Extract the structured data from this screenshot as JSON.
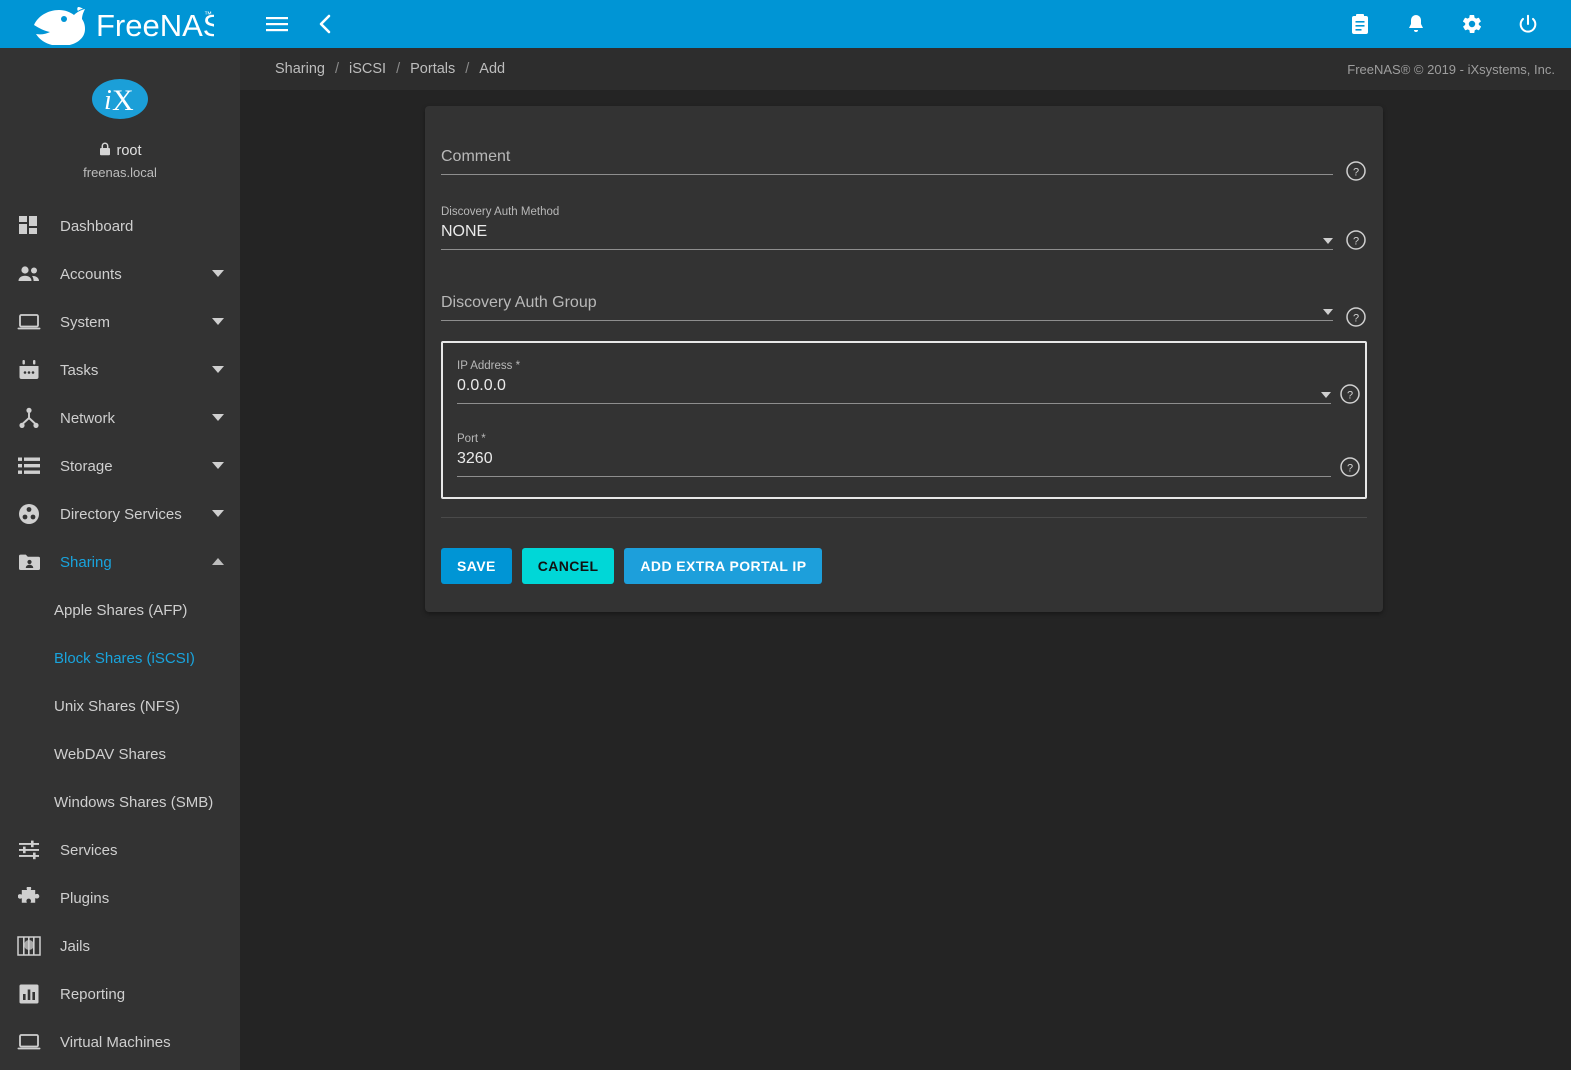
{
  "topbar": {
    "logo_text": "FreeNAS",
    "menu_icon": "hamburger-menu-icon",
    "back_icon": "chevron-left-icon",
    "right_icons": [
      {
        "name": "tasks-clipboard-icon",
        "label": "Tasks"
      },
      {
        "name": "notifications-bell-icon",
        "label": "Notifications"
      },
      {
        "name": "settings-gear-icon",
        "label": "Settings"
      },
      {
        "name": "power-icon",
        "label": "Power"
      }
    ]
  },
  "breadcrumb": {
    "items": [
      "Sharing",
      "iSCSI",
      "Portals",
      "Add"
    ],
    "separator": "/"
  },
  "copyright": "FreeNAS® © 2019 - iXsystems, Inc.",
  "sidebar": {
    "avatar_text": "iX",
    "user": "root",
    "host": "freenas.local",
    "lock_icon": "lock-icon",
    "items": [
      {
        "label": "Dashboard",
        "icon": "dashboard-icon",
        "expandable": false,
        "active": false
      },
      {
        "label": "Accounts",
        "icon": "accounts-people-icon",
        "expandable": true,
        "active": false
      },
      {
        "label": "System",
        "icon": "system-laptop-icon",
        "expandable": true,
        "active": false
      },
      {
        "label": "Tasks",
        "icon": "tasks-calendar-icon",
        "expandable": true,
        "active": false
      },
      {
        "label": "Network",
        "icon": "network-share-icon",
        "expandable": true,
        "active": false
      },
      {
        "label": "Storage",
        "icon": "storage-list-icon",
        "expandable": true,
        "active": false
      },
      {
        "label": "Directory Services",
        "icon": "directory-services-icon",
        "expandable": true,
        "active": false
      },
      {
        "label": "Sharing",
        "icon": "sharing-folder-icon",
        "expandable": true,
        "active": true,
        "expanded": true
      }
    ],
    "sharing_children": [
      {
        "label": "Apple Shares (AFP)",
        "active": false
      },
      {
        "label": "Block Shares (iSCSI)",
        "active": true
      },
      {
        "label": "Unix Shares (NFS)",
        "active": false
      },
      {
        "label": "WebDAV Shares",
        "active": false
      },
      {
        "label": "Windows Shares (SMB)",
        "active": false
      }
    ],
    "items_after": [
      {
        "label": "Services",
        "icon": "services-sliders-icon",
        "expandable": false,
        "active": false
      },
      {
        "label": "Plugins",
        "icon": "plugins-puzzle-icon",
        "expandable": false,
        "active": false
      },
      {
        "label": "Jails",
        "icon": "jails-icon",
        "expandable": false,
        "active": false
      },
      {
        "label": "Reporting",
        "icon": "reporting-chart-icon",
        "expandable": false,
        "active": false
      },
      {
        "label": "Virtual Machines",
        "icon": "virtual-machines-icon",
        "expandable": false,
        "active": false
      }
    ]
  },
  "form": {
    "fields": [
      {
        "name": "comment",
        "label": "Comment",
        "value": "",
        "placeholder": "Comment",
        "type": "text",
        "required": false,
        "help_icon": "help-circle-icon"
      },
      {
        "name": "discovery_auth_method",
        "label": "Discovery Auth Method",
        "value": "NONE",
        "placeholder": "",
        "type": "select",
        "required": false,
        "help_icon": "help-circle-icon"
      },
      {
        "name": "discovery_auth_group",
        "label": "Discovery Auth Group",
        "value": "",
        "placeholder": "Discovery Auth Group",
        "type": "select",
        "required": false,
        "help_icon": "help-circle-icon"
      }
    ],
    "portal_group": {
      "ip_address": {
        "label": "IP Address *",
        "value": "0.0.0.0",
        "type": "select",
        "required": true,
        "help_icon": "help-circle-icon"
      },
      "port": {
        "label": "Port *",
        "value": "3260",
        "type": "text",
        "required": true,
        "help_icon": "help-circle-icon"
      }
    },
    "buttons": {
      "save": "SAVE",
      "cancel": "CANCEL",
      "add_extra": "ADD EXTRA PORTAL IP"
    }
  },
  "colors": {
    "brand_blue": "#0095d5",
    "accent_cyan": "#00d7d7",
    "active_link": "#19a4dd",
    "sidebar_bg": "#333333",
    "page_bg": "#242424",
    "card_bg": "#333333"
  }
}
